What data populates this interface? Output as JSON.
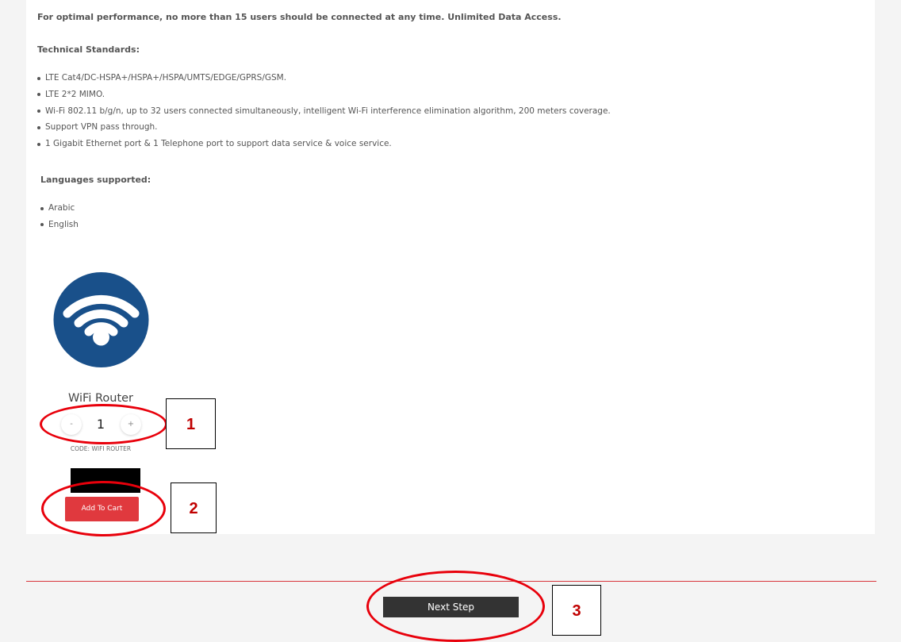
{
  "intro_text": "For optimal performance, no more than 15 users should be connected at any time. Unlimited Data Access.",
  "technical": {
    "title": "Technical Standards:",
    "items": [
      "LTE Cat4/DC-HSPA+/HSPA+/HSPA/UMTS/EDGE/GPRS/GSM.",
      "LTE 2*2 MIMO.",
      "Wi-Fi 802.11 b/g/n, up to 32 users connected simultaneously, intelligent Wi-Fi interference elimination algorithm, 200 meters coverage.",
      "Support VPN pass through.",
      "1 Gigabit Ethernet port & 1 Telephone port to support data service & voice service."
    ]
  },
  "languages": {
    "title": "Languages supported:",
    "items": [
      "Arabic",
      "English"
    ]
  },
  "product": {
    "icon": "wifi-icon",
    "name": "WiFi Router",
    "quantity": "1",
    "minus_label": "-",
    "plus_label": "+",
    "code": "CODE: WIFI ROUTER",
    "add_to_cart_label": "Add To Cart"
  },
  "footer": {
    "next_step_label": "Next Step"
  },
  "annotations": [
    {
      "label": "1",
      "target": "quantity-stepper"
    },
    {
      "label": "2",
      "target": "add-to-cart-button"
    },
    {
      "label": "3",
      "target": "next-step-button"
    }
  ],
  "colors": {
    "wifi_circle": "#19508a",
    "add_to_cart": "#e0393e",
    "next_step": "#333333",
    "divider": "#d8373d",
    "annotation_red": "#e8000b"
  }
}
